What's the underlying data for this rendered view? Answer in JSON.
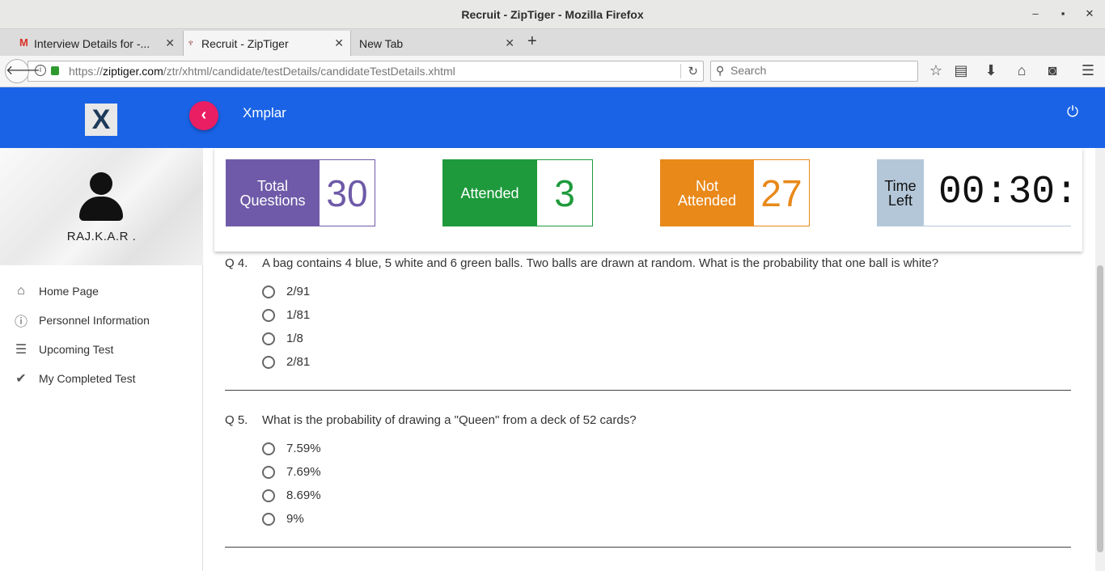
{
  "window": {
    "title": "Recruit - ZipTiger - Mozilla Firefox",
    "minimize": "‒",
    "maximize": "▪",
    "close": "✕"
  },
  "tabs": [
    {
      "label": "Interview Details for -...",
      "favicon": "gmail-icon",
      "close": "✕"
    },
    {
      "label": "Recruit - ZipTiger",
      "favicon": "ziptiger-icon",
      "close": "✕"
    },
    {
      "label": "New Tab",
      "favicon": "",
      "close": "✕"
    }
  ],
  "newtab": "+",
  "nav": {
    "url_scheme": "https://",
    "url_host": "ziptiger.com",
    "url_path": "/ztr/xhtml/candidate/testDetails/candidateTestDetails.xhtml",
    "search_placeholder": "Search"
  },
  "app": {
    "logo_letter": "X",
    "title": "Xmplar",
    "collapse_glyph": "‹",
    "power_glyph": "⏻"
  },
  "sidebar": {
    "username": "RAJ.K.A.R .",
    "items": [
      {
        "label": "Home Page",
        "icon": "home-icon",
        "glyph": "⌂"
      },
      {
        "label": "Personnel Information",
        "icon": "info-icon",
        "glyph": "ⓘ"
      },
      {
        "label": "Upcoming Test",
        "icon": "list-icon",
        "glyph": "☰"
      },
      {
        "label": "My Completed Test",
        "icon": "check-icon",
        "glyph": "✔"
      }
    ]
  },
  "stats": {
    "total": {
      "label_line1": "Total",
      "label_line2": "Questions",
      "value": "30",
      "color": "#6e5aa8"
    },
    "attended": {
      "label": "Attended",
      "value": "3",
      "color": "#1e9a3c"
    },
    "not_attended": {
      "label_line1": "Not",
      "label_line2": "Attended",
      "value": "27",
      "color": "#e8891a"
    },
    "time_left": {
      "label_line1": "Time",
      "label_line2": "Left",
      "value": "00:30:",
      "color": "#b4c7d8"
    }
  },
  "questions": [
    {
      "num": "Q 4.",
      "text": "A bag contains 4 blue, 5 white and 6 green balls. Two balls are drawn at random. What is the probability that one ball is white?",
      "options": [
        "2/91",
        "1/81",
        "1/8",
        "2/81"
      ]
    },
    {
      "num": "Q 5.",
      "text": "What is the probability of drawing a \"Queen\" from a deck of 52 cards?",
      "options": [
        "7.59%",
        "7.69%",
        "8.69%",
        "9%"
      ]
    }
  ]
}
